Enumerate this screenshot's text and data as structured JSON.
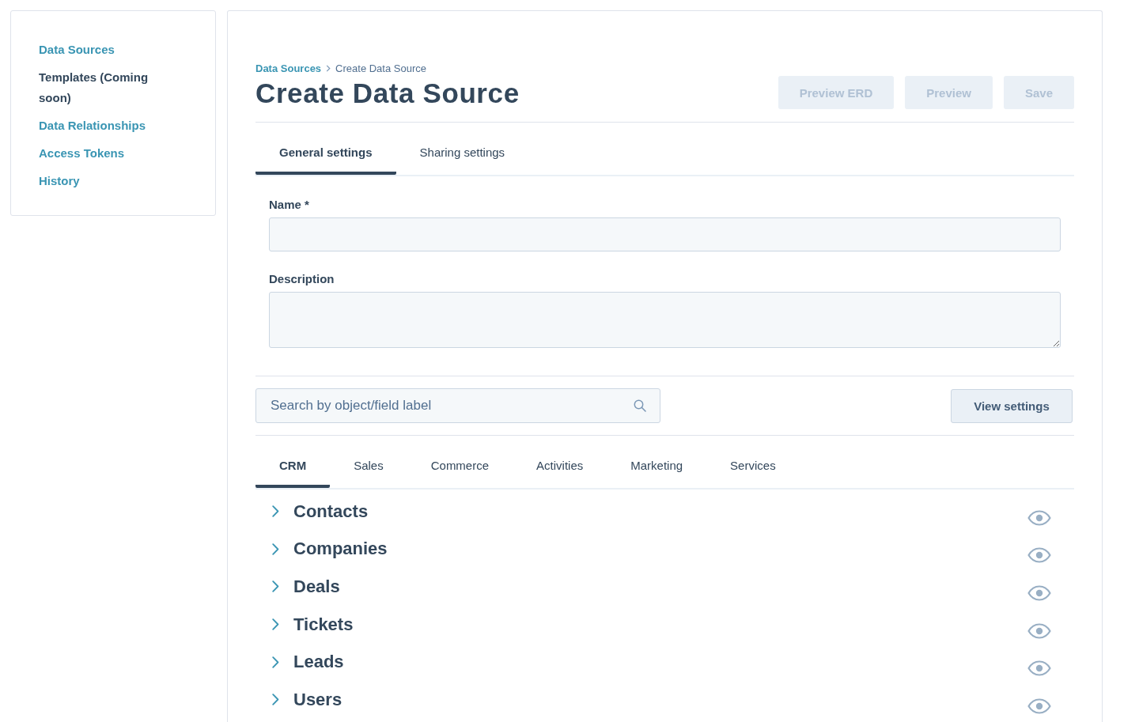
{
  "sidebar": {
    "items": [
      {
        "label": "Data Sources",
        "disabled": false
      },
      {
        "label": "Templates (Coming soon)",
        "disabled": true
      },
      {
        "label": "Data Relationships",
        "disabled": false
      },
      {
        "label": "Access Tokens",
        "disabled": false
      },
      {
        "label": "History",
        "disabled": false
      }
    ]
  },
  "breadcrumb": [
    {
      "label": "Data Sources",
      "kind": "link"
    },
    {
      "label": "Create Data Source",
      "kind": "current"
    }
  ],
  "page_title": "Create Data Source",
  "header_buttons": [
    {
      "label": "Preview ERD",
      "disabled": true
    },
    {
      "label": "Preview",
      "disabled": true
    },
    {
      "label": "Save",
      "disabled": true
    }
  ],
  "settings_tabs": [
    {
      "label": "General settings",
      "selected": true
    },
    {
      "label": "Sharing settings",
      "selected": false
    }
  ],
  "form": {
    "fields": [
      {
        "label": "Name *",
        "kind": "input"
      },
      {
        "label": "Description",
        "kind": "textarea"
      }
    ]
  },
  "search": {
    "placeholder": "Search by object/field label"
  },
  "view_settings_button": {
    "label": "View settings"
  },
  "object_tabs": [
    {
      "label": "CRM",
      "selected": true
    },
    {
      "label": "Sales",
      "selected": false
    },
    {
      "label": "Commerce",
      "selected": false
    },
    {
      "label": "Activities",
      "selected": false
    },
    {
      "label": "Marketing",
      "selected": false
    },
    {
      "label": "Services",
      "selected": false
    }
  ],
  "objects": [
    {
      "label": "Contacts",
      "expanded": false,
      "visible": true
    },
    {
      "label": "Companies",
      "expanded": false,
      "visible": true
    },
    {
      "label": "Deals",
      "expanded": false,
      "visible": true
    },
    {
      "label": "Tickets",
      "expanded": false,
      "visible": true
    },
    {
      "label": "Leads",
      "expanded": false,
      "visible": true
    },
    {
      "label": "Users",
      "expanded": false,
      "visible": true
    }
  ]
}
